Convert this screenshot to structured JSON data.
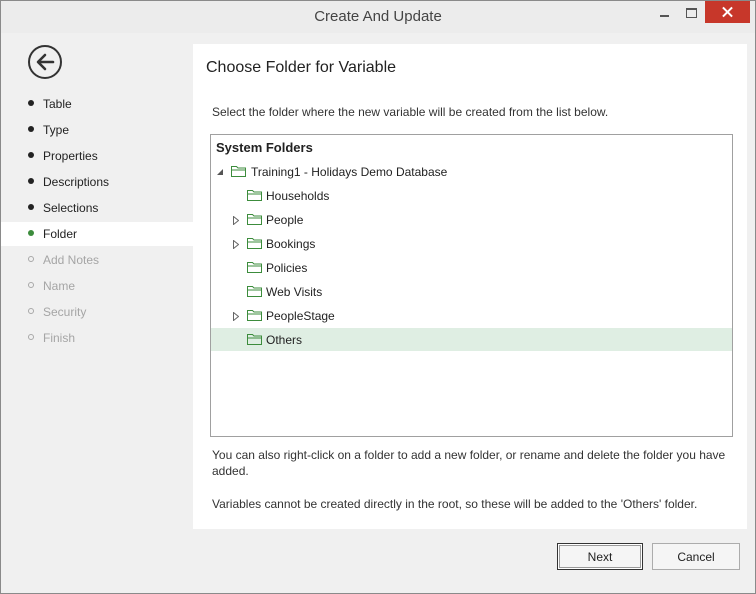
{
  "window": {
    "title": "Create And Update"
  },
  "sidebar": {
    "items": [
      {
        "label": "Table",
        "state": "done"
      },
      {
        "label": "Type",
        "state": "done"
      },
      {
        "label": "Properties",
        "state": "done"
      },
      {
        "label": "Descriptions",
        "state": "done"
      },
      {
        "label": "Selections",
        "state": "done"
      },
      {
        "label": "Folder",
        "state": "current"
      },
      {
        "label": "Add Notes",
        "state": "disabled"
      },
      {
        "label": "Name",
        "state": "disabled"
      },
      {
        "label": "Security",
        "state": "disabled"
      },
      {
        "label": "Finish",
        "state": "disabled"
      }
    ]
  },
  "main": {
    "heading": "Choose Folder for Variable",
    "instruction": "Select the folder where the new variable will be created from the list below.",
    "tree": {
      "header": "System Folders",
      "root": "Training1 - Holidays Demo Database",
      "folders": [
        {
          "label": "Households",
          "expandable": false
        },
        {
          "label": "People",
          "expandable": true
        },
        {
          "label": "Bookings",
          "expandable": true
        },
        {
          "label": "Policies",
          "expandable": false
        },
        {
          "label": "Web Visits",
          "expandable": false
        },
        {
          "label": "PeopleStage",
          "expandable": true
        },
        {
          "label": "Others",
          "expandable": false,
          "selected": true
        }
      ]
    },
    "note1": "You can also right-click on a folder to add a new folder, or rename and delete the folder you have added.",
    "note2": "Variables cannot be created directly in the root, so these will be added to the 'Others' folder."
  },
  "footer": {
    "next_label": "Next",
    "cancel_label": "Cancel"
  },
  "colors": {
    "accent_green": "#3c8c3c",
    "selection": "#dfeee3",
    "folder": "#3c8c3c",
    "close": "#c7372a"
  }
}
